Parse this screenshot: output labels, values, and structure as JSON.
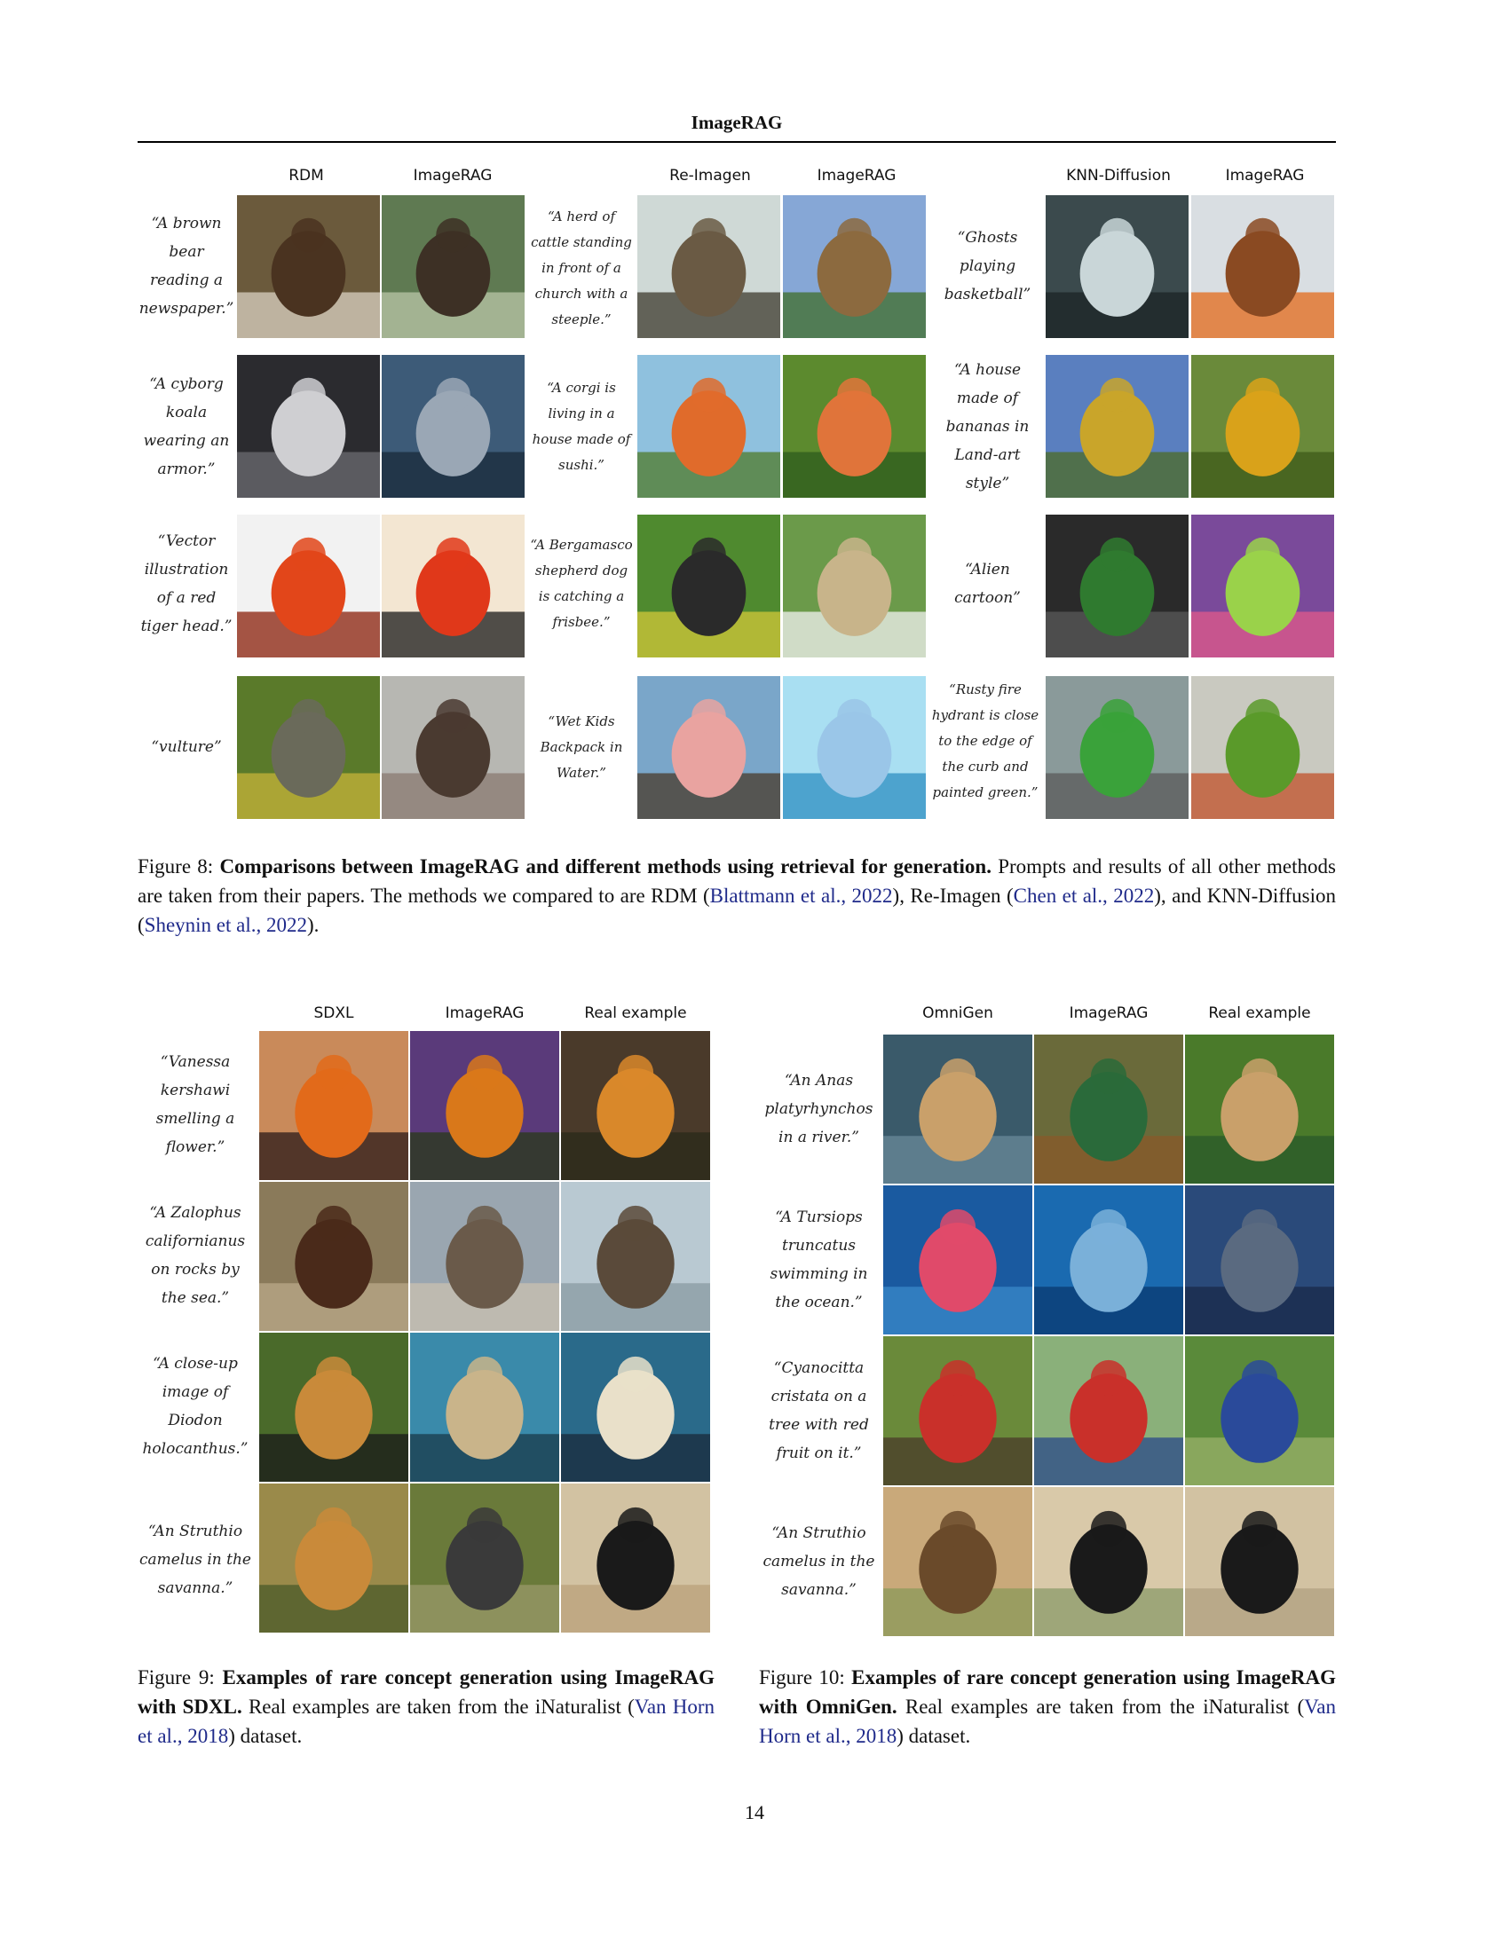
{
  "running_head": "ImageRAG",
  "fig8": {
    "headers": [
      "RDM",
      "ImageRAG",
      "Re-Imagen",
      "ImageRAG",
      "KNN-Diffusion",
      "ImageRAG"
    ],
    "prompts": [
      "“A brown bear reading a newspaper.”",
      "“A herd of cattle standing in front of a church with a steeple.”",
      "“Ghosts playing basketball”",
      "“A cyborg koala wearing an armor.”",
      "“A corgi is living in a house made of sushi.”",
      "“A house made of bananas in Land-art style”",
      "“Vector illustration of a red tiger head.”",
      "“A Bergamasco shepherd dog is catching a frisbee.”",
      "“Alien cartoon”",
      "“vulture”",
      "“Wet Kids Backpack in Water.”",
      "“Rusty fire hydrant is close to the edge of the curb and painted green.”"
    ],
    "caption_label": "Figure 8:",
    "caption_bold": "Comparisons between ImageRAG and different methods using retrieval for generation.",
    "caption_text1": "Prompts and results of all other methods are taken from their papers. The methods we compared to are RDM (",
    "cite1": "Blattmann et al., 2022",
    "caption_text2": "), Re-Imagen (",
    "cite2": "Chen et al., 2022",
    "caption_text3": "), and KNN-Diffusion (",
    "cite3": "Sheynin et al., 2022",
    "caption_text4": ")."
  },
  "fig9": {
    "headers": [
      "SDXL",
      "ImageRAG",
      "Real example"
    ],
    "prompts": [
      "“Vanessa kershawi smelling a flower.”",
      "“A Zalophus californianus on rocks by the sea.”",
      "“A close-up image of Diodon holocanthus.”",
      "“An Struthio camelus in the savanna.”"
    ],
    "caption_label": "Figure 9:",
    "caption_bold": "Examples of rare concept generation using ImageRAG with SDXL.",
    "caption_text1": "Real examples are taken from the iNaturalist (",
    "cite": "Van Horn et al., 2018",
    "caption_text2": ") dataset."
  },
  "fig10": {
    "headers": [
      "OmniGen",
      "ImageRAG",
      "Real example"
    ],
    "prompts": [
      "“An Anas platyrhynchos in a river.”",
      "“A Tursiops truncatus swimming in the ocean.”",
      "“Cyanocitta cristata on a tree with red fruit on it.”",
      "“An Struthio camelus in the savanna.”"
    ],
    "caption_label": "Figure 10:",
    "caption_bold": "Examples of rare concept generation using ImageRAG with OmniGen.",
    "caption_text1": "Real examples are taken from the iNaturalist (",
    "cite": "Van Horn et al., 2018",
    "caption_text2": ") dataset."
  },
  "page_number": "14",
  "image_palettes": {
    "bear": [
      "#6b5a3c",
      "#4a3320",
      "#d9d2c2"
    ],
    "forest": [
      "#5f7a52",
      "#3d3025",
      "#b9c7a8"
    ],
    "church": [
      "#cfd9d6",
      "#6a5a44",
      "#3d3a2e"
    ],
    "herd": [
      "#86a7d6",
      "#8c6a3f",
      "#3f6e2a"
    ],
    "ghosts": [
      "#3b4a4d",
      "#c9d6d8",
      "#1c2426"
    ],
    "ball": [
      "#d9dee2",
      "#8a4a22",
      "#e36a1a"
    ],
    "robot-koala": [
      "#2b2b2f",
      "#cfcfd2",
      "#6c6c72"
    ],
    "armor-koala": [
      "#3d5b78",
      "#9aa7b5",
      "#1a2a3a"
    ],
    "sushi-house": [
      "#8fc1de",
      "#e06b2b",
      "#4f7a2a"
    ],
    "sushi-corgi": [
      "#5c8a2e",
      "#e0743a",
      "#2e5b1d"
    ],
    "banana-house": [
      "#5a7fbf",
      "#c9a52a",
      "#4d6b25"
    ],
    "banana-hut": [
      "#6a8a3a",
      "#d9a21a",
      "#3f5a1a"
    ],
    "tiger-red": [
      "#f2f2f2",
      "#e2461a",
      "#8a1f0a"
    ],
    "tiger-stripes": [
      "#f3e6d2",
      "#e0381a",
      "#1a1a1a"
    ],
    "dog-lawn": [
      "#4f8a2f",
      "#2a2a2a",
      "#d1c73a"
    ],
    "dog-frisbee": [
      "#6b9a4a",
      "#c8b48a",
      "#f2f2f2"
    ],
    "alien-green": [
      "#2a2a2a",
      "#2f7a2f",
      "#5a5a5a"
    ],
    "alien-cartoon": [
      "#7a4a9a",
      "#9ad24a",
      "#e25a8a"
    ],
    "bird-green": [
      "#5a7a2a",
      "#6a6a5a",
      "#c7b43a"
    ],
    "vulture": [
      "#b7b7b2",
      "#4a3a30",
      "#8a7a70"
    ],
    "backpack-lake": [
      "#7aa6c9",
      "#e9a3a0",
      "#4a3a2a"
    ],
    "backpack-water": [
      "#a9dff2",
      "#9ac6e8",
      "#2f8fc1"
    ],
    "hydrant-green": [
      "#8a9a9a",
      "#3aa23a",
      "#5a5a5a"
    ],
    "hydrant-rusty": [
      "#c9c9c0",
      "#5a9a2a",
      "#c0502a"
    ],
    "butterfly-woman": [
      "#c98a5a",
      "#e26a1a",
      "#2a1a1a"
    ],
    "butterfly-lilac": [
      "#5a3a7a",
      "#d9781a",
      "#2a3a1a"
    ],
    "butterfly-ground": [
      "#4a3a2a",
      "#d9882a",
      "#2a2a1a"
    ],
    "crab-rocks": [
      "#8a7a5a",
      "#4a2a1a",
      "#b9a98a"
    ],
    "sealion-rocks": [
      "#9aa6b0",
      "#6a5a4a",
      "#c9c0b0"
    ],
    "sealion-chain": [
      "#b9c9d2",
      "#5a4a3a",
      "#8a9aa2"
    ],
    "spider": [
      "#4a6a2a",
      "#c98a3a",
      "#1a1a1a"
    ],
    "pufferfish-blue": [
      "#3a8aaa",
      "#c9b48a",
      "#1a3a4a"
    ],
    "pufferfish-real": [
      "#2a6a8a",
      "#e9e0c9",
      "#1a2a3a"
    ],
    "camel": [
      "#9a8a4a",
      "#c98a3a",
      "#4a5a2a"
    ],
    "ostrich-grass": [
      "#6a7a3a",
      "#3a3a3a",
      "#9a9a6a"
    ],
    "ostrich-dirt": [
      "#d2c2a2",
      "#1a1a1a",
      "#b9a07a"
    ],
    "deer-water": [
      "#3a5a6a",
      "#c9a06a",
      "#6a8a9a"
    ],
    "duck-pond": [
      "#6a6a3a",
      "#2a6a3a",
      "#8a5a2a"
    ],
    "duck-grass": [
      "#4a7a2a",
      "#c9a06a",
      "#2a5a2a"
    ],
    "fish-pink": [
      "#1a5aa0",
      "#e04a6a",
      "#3a8ac9"
    ],
    "dolphin-blue": [
      "#1a6ab0",
      "#7ab0d9",
      "#0a3a70"
    ],
    "dolphin-sea": [
      "#2a4a7a",
      "#5a6a80",
      "#1a2a4a"
    ],
    "tree-bird": [
      "#6a8a3a",
      "#c9302a",
      "#4a3a2a"
    ],
    "bluejay-berries": [
      "#8ab07a",
      "#c9302a",
      "#2a4a8a"
    ],
    "bluejay-grass": [
      "#5a8a3a",
      "#2a4a9a",
      "#9ab06a"
    ],
    "camel-savanna": [
      "#c9a97a",
      "#6a4a2a",
      "#8a9a5a"
    ],
    "ostrich-savanna": [
      "#d9c9a9",
      "#1a1a1a",
      "#8a9a6a"
    ],
    "ostrich-real2": [
      "#d2c2a2",
      "#1a1a1a",
      "#b0a080"
    ]
  }
}
